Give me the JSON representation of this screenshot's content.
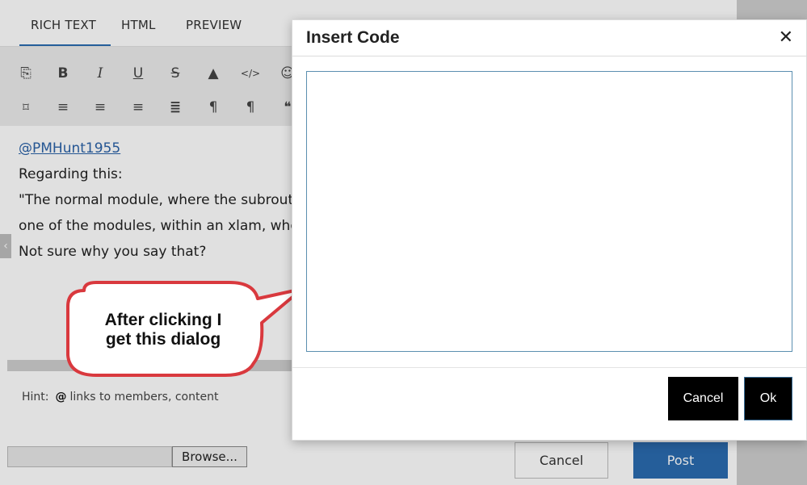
{
  "editor": {
    "tabs": [
      {
        "label": "RICH TEXT",
        "active": true
      },
      {
        "label": "HTML",
        "active": false
      },
      {
        "label": "PREVIEW",
        "active": false
      }
    ],
    "toolbar_row1_icons": [
      "paste-icon",
      "bold-icon",
      "italic-icon",
      "underline-icon",
      "strikethrough-icon",
      "text-color-icon",
      "code-icon",
      "emoji-icon"
    ],
    "toolbar_row2_icons": [
      "bookmark-icon",
      "align-left-icon",
      "align-center-icon",
      "align-right-icon",
      "justify-icon",
      "ltr-paragraph-icon",
      "rtl-paragraph-icon",
      "quote-icon"
    ],
    "content": {
      "mention": "@PMHunt1955",
      "line1": "Regarding this:",
      "line2": "\"The normal module, where the subroutir",
      "line3": "one of the modules, within an xlam, wher",
      "line4": "Not sure why you say that?"
    },
    "hint": {
      "label": "Hint:",
      "symbol": "@",
      "text": "links to members, content"
    },
    "browse_label": "Browse...",
    "cancel_label": "Cancel",
    "post_label": "Post"
  },
  "callout": {
    "text": "After clicking I get this dialog"
  },
  "dialog": {
    "title": "Insert Code",
    "code_value": "",
    "cancel_label": "Cancel",
    "ok_label": "Ok"
  },
  "colors": {
    "accent": "#2b6cb0",
    "callout_border": "#d9393e",
    "dialog_button": "#000000"
  }
}
